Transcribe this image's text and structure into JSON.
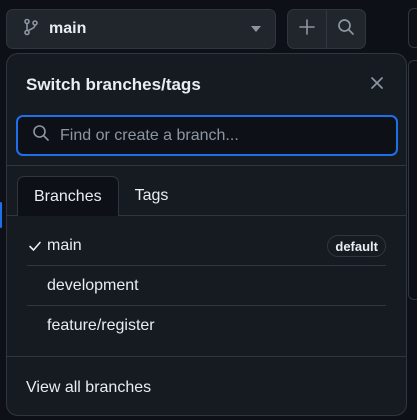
{
  "toolbar": {
    "branch_icon": "git-branch-icon",
    "current_branch": "main",
    "caret_icon": "triangle-down-icon",
    "add_icon": "plus-icon",
    "search_icon": "search-icon"
  },
  "dropdown": {
    "title": "Switch branches/tags",
    "close_icon": "x-icon",
    "search": {
      "placeholder": "Find or create a branch...",
      "value": "",
      "icon": "search-icon"
    },
    "tabs": [
      {
        "label": "Branches",
        "active": true
      },
      {
        "label": "Tags",
        "active": false
      }
    ],
    "branches": [
      {
        "name": "main",
        "selected": true,
        "badge": "default"
      },
      {
        "name": "development",
        "selected": false
      },
      {
        "name": "feature/register",
        "selected": false
      }
    ],
    "view_all_label": "View all branches"
  },
  "colors": {
    "background": "#0d1117",
    "panel": "#161b22",
    "border": "#30363d",
    "accent": "#1f6feb",
    "text": "#e6edf3",
    "muted": "#8d96a0"
  }
}
